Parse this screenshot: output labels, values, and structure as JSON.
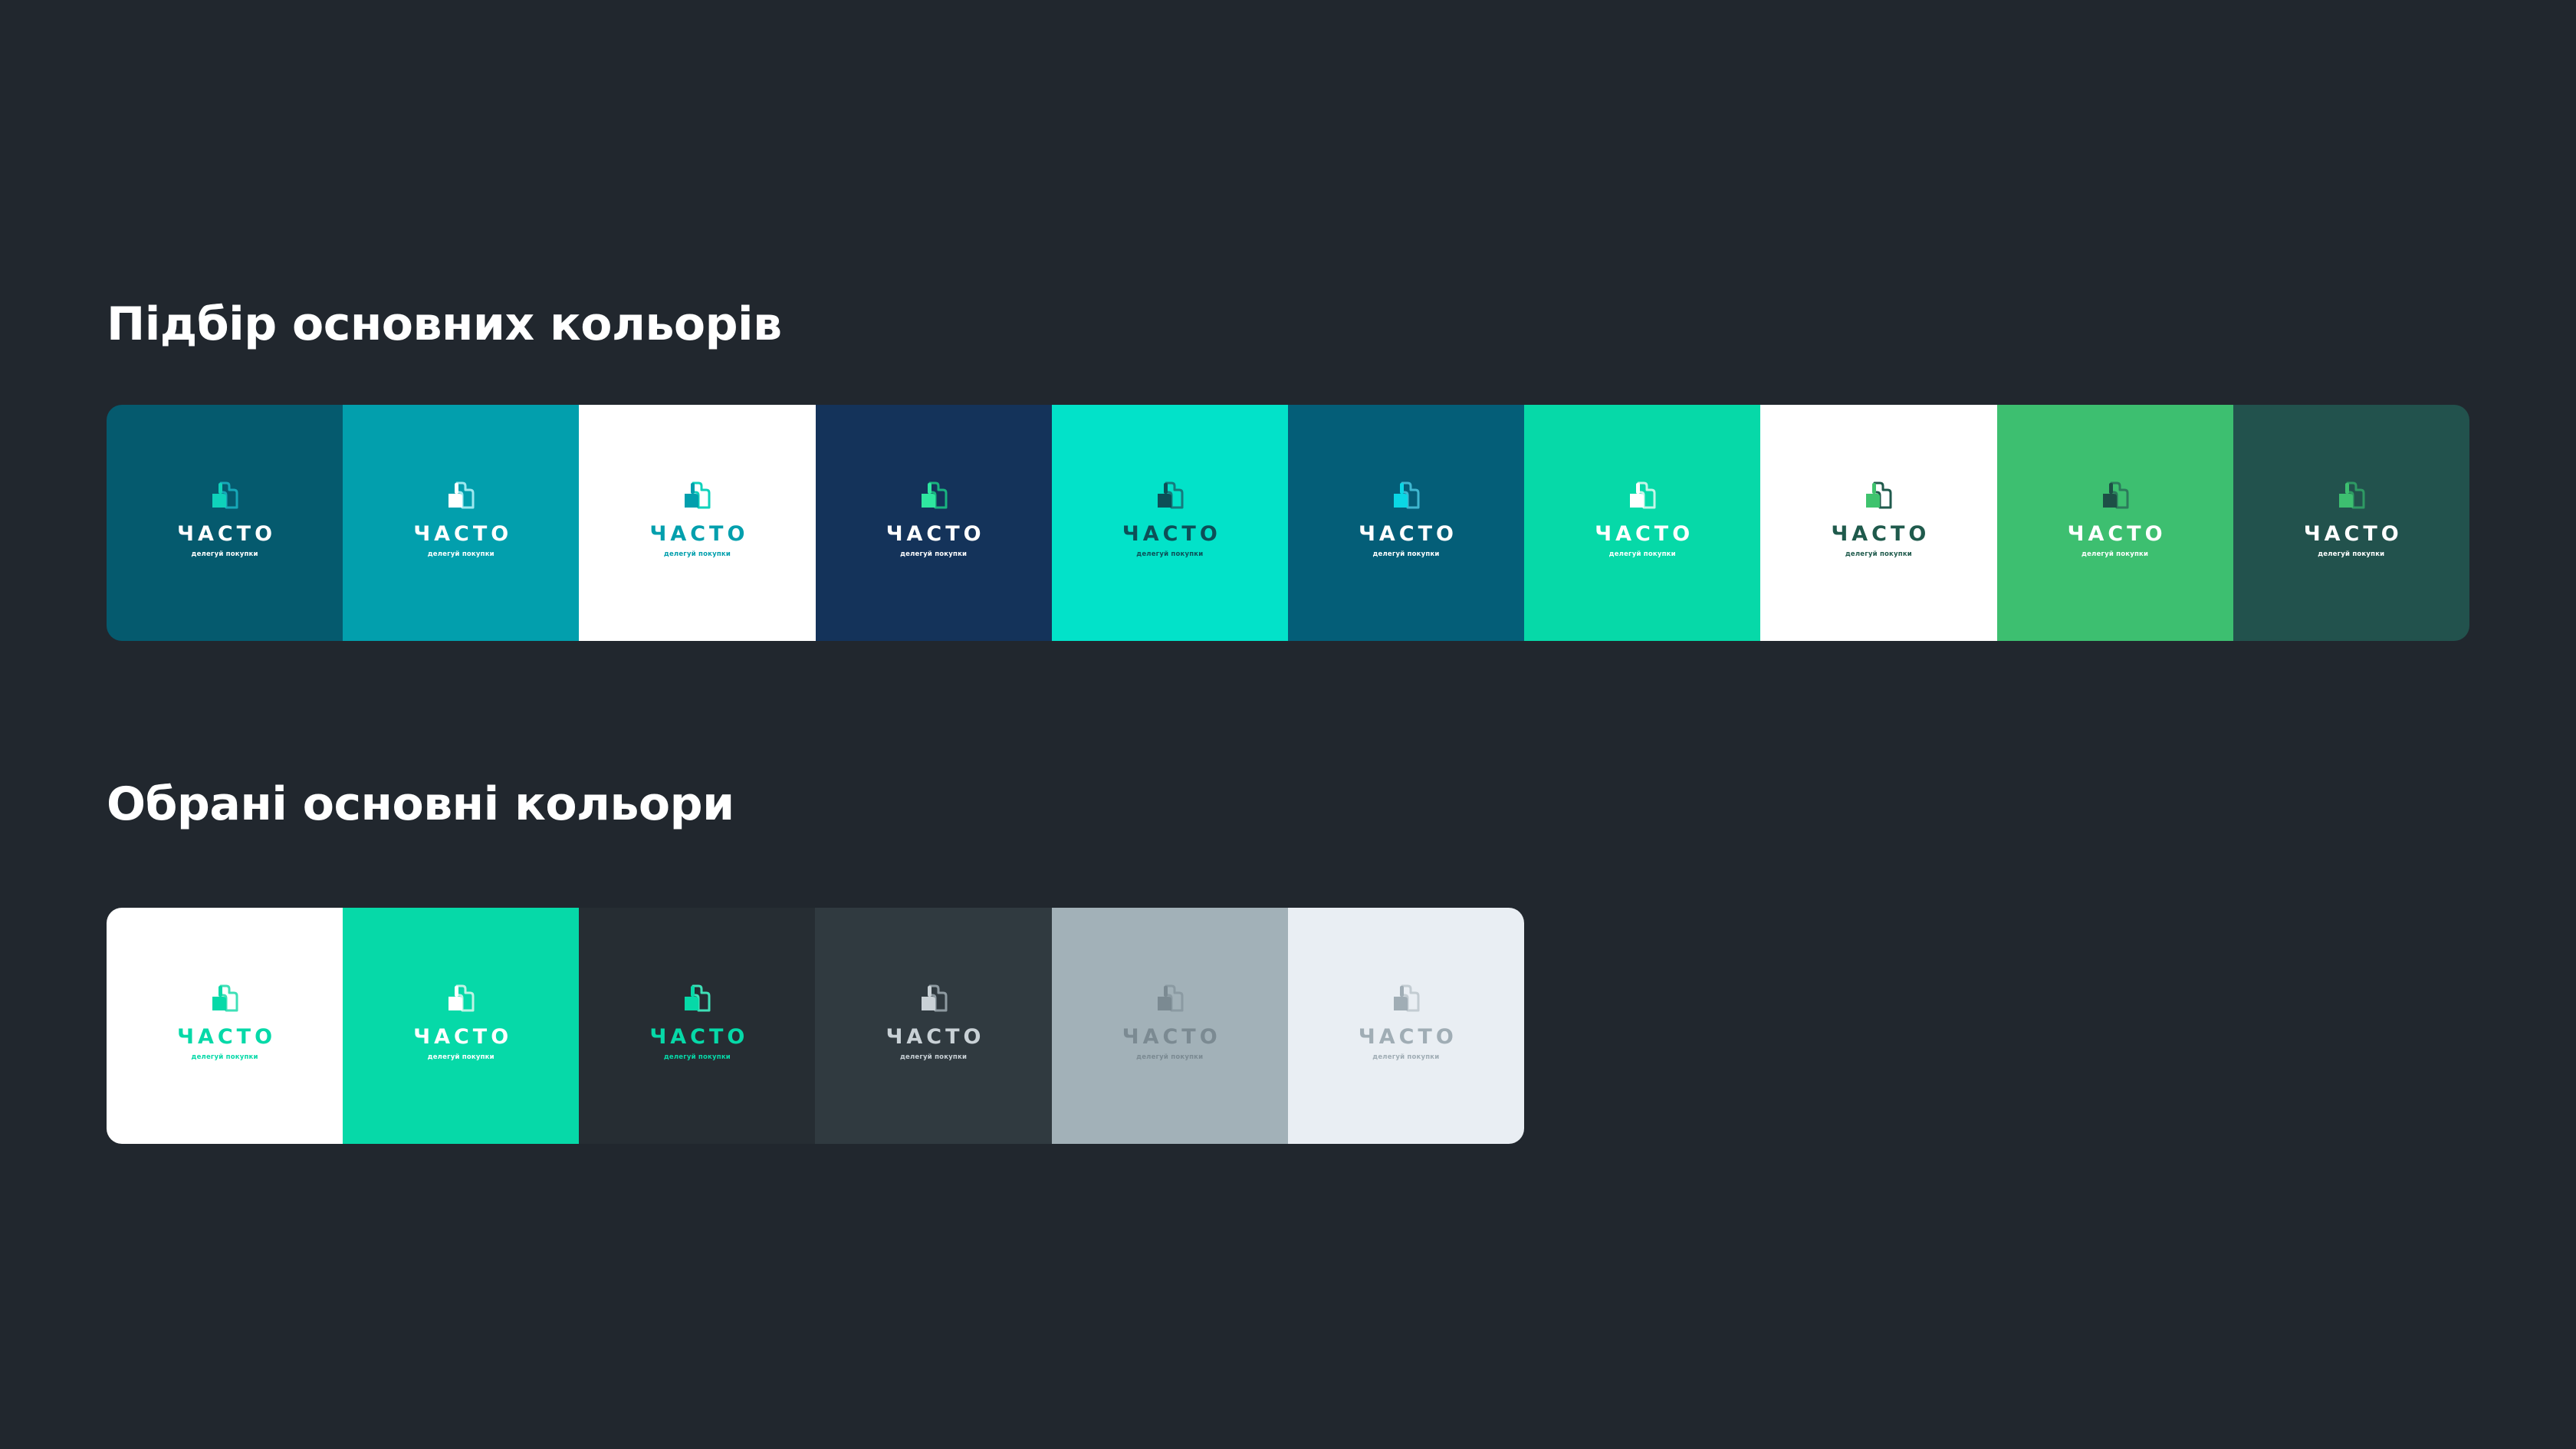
{
  "sections": [
    {
      "title": "Підбір основних кольорів",
      "swatches": [
        {
          "bg": "#055a6e",
          "front": "#0fd2bb",
          "back": "#16a8b8",
          "word": "#ffffff",
          "tag": "#ffffff"
        },
        {
          "bg": "#029fad",
          "front": "#ffffff",
          "back": "#9ee8ef",
          "word": "#ffffff",
          "tag": "#ffffff"
        },
        {
          "bg": "#ffffff",
          "front": "#029fad",
          "back": "#0fd2bb",
          "word": "#029fad",
          "tag": "#029fad"
        },
        {
          "bg": "#14335a",
          "front": "#2fe6a0",
          "back": "#19b37f",
          "word": "#ffffff",
          "tag": "#ffffff"
        },
        {
          "bg": "#02e2c9",
          "front": "#0d4f57",
          "back": "#167a7d",
          "word": "#0d4f57",
          "tag": "#0d4f57"
        },
        {
          "bg": "#045e78",
          "front": "#0ad7e5",
          "back": "#3fb7d0",
          "word": "#ffffff",
          "tag": "#ffffff"
        },
        {
          "bg": "#06d9a8",
          "front": "#ffffff",
          "back": "#c6f5e8",
          "word": "#ffffff",
          "tag": "#ffffff"
        },
        {
          "bg": "#ffffff",
          "front": "#3fc36e",
          "back": "#1f5a4c",
          "word": "#1f5a4c",
          "tag": "#1f5a4c"
        },
        {
          "bg": "#3dbf70",
          "front": "#1d4f46",
          "back": "#2c7a5b",
          "word": "#ffffff",
          "tag": "#ffffff"
        },
        {
          "bg": "#22524d",
          "front": "#3dbf70",
          "back": "#2e9a63",
          "word": "#ffffff",
          "tag": "#ffffff"
        }
      ]
    },
    {
      "title": "Обрані основні кольори",
      "swatches": [
        {
          "bg": "#ffffff",
          "front": "#06d9a8",
          "back": "#3fe0b7",
          "word": "#06d9a8",
          "tag": "#06d9a8"
        },
        {
          "bg": "#06d9a8",
          "front": "#ffffff",
          "back": "#bff3e4",
          "word": "#ffffff",
          "tag": "#ffffff"
        },
        {
          "bg": "#262d33",
          "front": "#06d9a8",
          "back": "#3fe0b7",
          "word": "#06d9a8",
          "tag": "#06d9a8"
        },
        {
          "bg": "#303a40",
          "front": "#c9d1d6",
          "back": "#8e9aa1",
          "word": "#c9d1d6",
          "tag": "#c9d1d6"
        },
        {
          "bg": "#a2b1b8",
          "front": "#7b8a92",
          "back": "#8b9aa2",
          "word": "#7b8a92",
          "tag": "#7b8a92"
        },
        {
          "bg": "#e9eef3",
          "front": "#a0adb5",
          "back": "#c3ccd2",
          "word": "#a0adb5",
          "tag": "#a0adb5"
        }
      ]
    }
  ],
  "logo": {
    "wordmark": "ЧАСТО",
    "tagline": "делегуй покупки",
    "icon": "shopping-bag-icon"
  }
}
